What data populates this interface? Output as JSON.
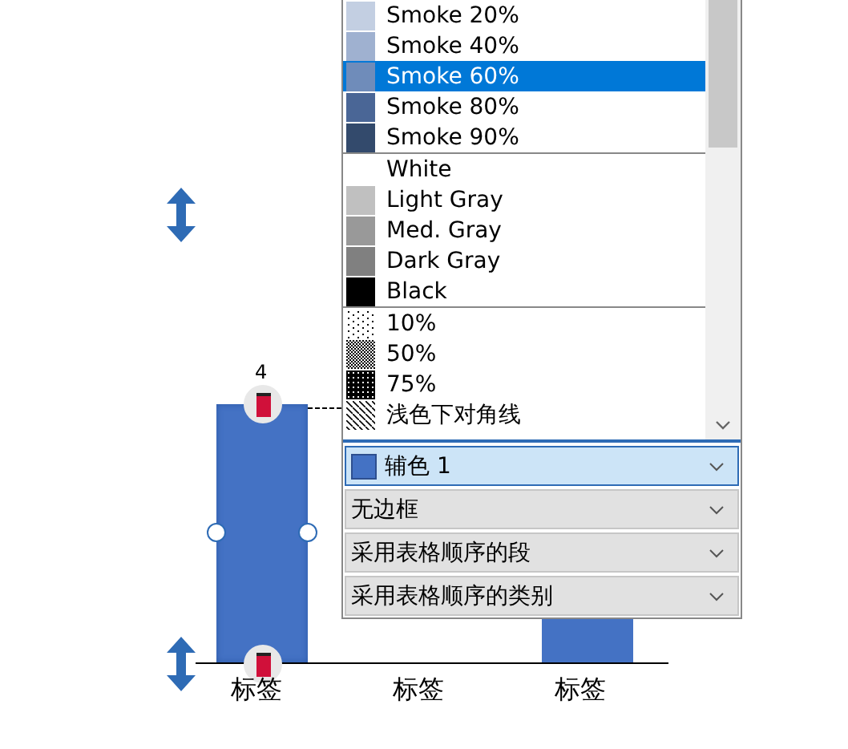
{
  "chart": {
    "data_label": "4",
    "categories": [
      "标签",
      "标签",
      "标签"
    ]
  },
  "color_list": {
    "groups": [
      {
        "items": [
          {
            "label": "Smoke 20%",
            "kind": "swatch",
            "color": "#c3cfe2",
            "selected": false
          },
          {
            "label": "Smoke 40%",
            "kind": "swatch",
            "color": "#9fb1d0",
            "selected": false
          },
          {
            "label": "Smoke 60%",
            "kind": "swatch",
            "color": "#6f8cba",
            "selected": true
          },
          {
            "label": "Smoke 80%",
            "kind": "swatch",
            "color": "#4a6696",
            "selected": false
          },
          {
            "label": "Smoke 90%",
            "kind": "swatch",
            "color": "#334a6c",
            "selected": false
          }
        ]
      },
      {
        "items": [
          {
            "label": "White",
            "kind": "swatch",
            "color": "#ffffff",
            "selected": false
          },
          {
            "label": "Light Gray",
            "kind": "swatch",
            "color": "#c0c0c0",
            "selected": false
          },
          {
            "label": "Med. Gray",
            "kind": "swatch",
            "color": "#999999",
            "selected": false
          },
          {
            "label": "Dark Gray",
            "kind": "swatch",
            "color": "#808080",
            "selected": false
          },
          {
            "label": "Black",
            "kind": "swatch",
            "color": "#000000",
            "selected": false
          }
        ]
      },
      {
        "items": [
          {
            "label": "10%",
            "kind": "sparse",
            "selected": false
          },
          {
            "label": "50%",
            "kind": "medium",
            "selected": false
          },
          {
            "label": "75%",
            "kind": "dense",
            "selected": false
          },
          {
            "label": "浅色下对角线",
            "kind": "diagonal",
            "selected": false
          }
        ]
      }
    ]
  },
  "combos": [
    {
      "value": "辅色 1",
      "color": "#4472c4",
      "selected": true
    },
    {
      "value": "无边框",
      "selected": false
    },
    {
      "value": "采用表格顺序的段",
      "selected": false
    },
    {
      "value": "采用表格顺序的类别",
      "selected": false
    }
  ]
}
